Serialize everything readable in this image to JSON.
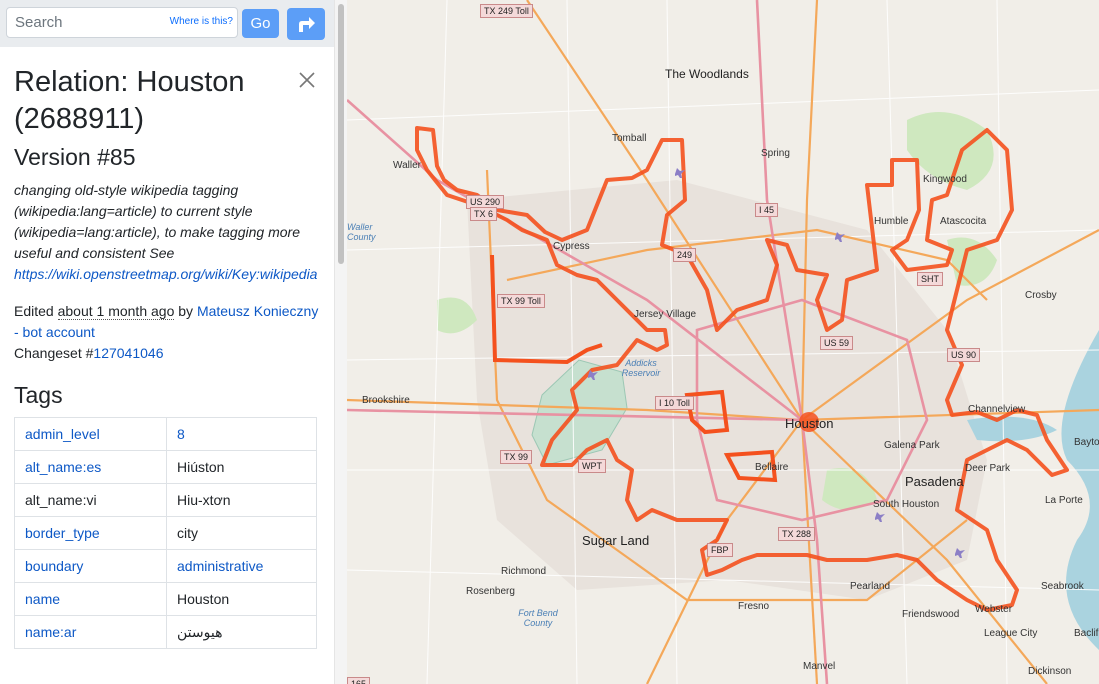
{
  "search": {
    "placeholder": "Search",
    "where_label": "Where is this?",
    "go_label": "Go"
  },
  "feature": {
    "title": "Relation: Houston (2688911)",
    "version": "Version #85",
    "comment_text": "changing old-style wikipedia tagging (wikipedia:lang=article) to current style (wikipedia=lang:article), to make tagging more useful and consistent See ",
    "comment_link": "https://wiki.openstreetmap.org/wiki/Key:wikipedia",
    "edited_prefix": "Edited ",
    "edited_time": "about 1 month ago",
    "edited_by": " by ",
    "editor": "Mateusz Konieczny - bot account",
    "changeset_label": "Changeset #",
    "changeset_id": "127041046"
  },
  "tags_heading": "Tags",
  "tags": [
    {
      "key": "admin_level",
      "value": "8"
    },
    {
      "key": "alt_name:es",
      "value": "Hiúston"
    },
    {
      "key": "alt_name:vi",
      "value": "Hiu-xtơn"
    },
    {
      "key": "border_type",
      "value": "city"
    },
    {
      "key": "boundary",
      "value": "administrative"
    },
    {
      "key": "name",
      "value": "Houston"
    },
    {
      "key": "name:ar",
      "value": "هيوستن"
    }
  ],
  "map": {
    "accent": "#f4511e",
    "places": [
      "The Woodlands",
      "Tomball",
      "Spring",
      "Waller",
      "Kingwood",
      "Humble",
      "Atascocita",
      "Cypress",
      "Jersey Village",
      "Crosby",
      "Houston",
      "Brookshire",
      "Channelview",
      "Galena Park",
      "Deer Park",
      "Pasadena",
      "South Houston",
      "Bellaire",
      "Sugar Land",
      "Richmond",
      "Rosenberg",
      "Pearland",
      "Fresno",
      "Friendswood",
      "Webster",
      "League City",
      "Seabrook",
      "La Porte",
      "Manvel",
      "Dickinson",
      "Bayto",
      "Baclif",
      "Addicks Reservoir",
      "Fort Bend County",
      "Waller County"
    ],
    "shields": [
      "TX 249 Toll",
      "US 290",
      "TX 6",
      "TX 99 Toll",
      "I 45",
      "249",
      "SHT",
      "US 59",
      "US 90",
      "I 10 Toll",
      "TX 99",
      "WPT",
      "TX 288",
      "FBP",
      "165"
    ]
  }
}
